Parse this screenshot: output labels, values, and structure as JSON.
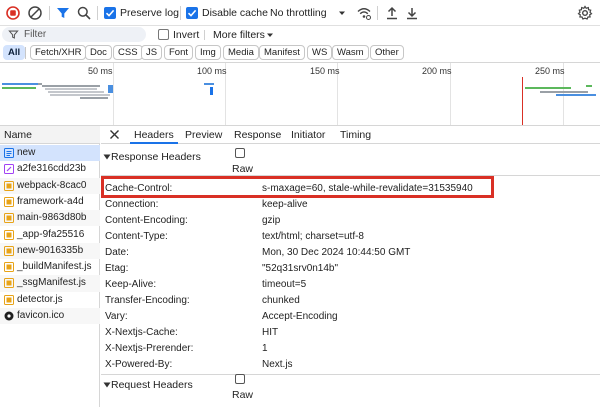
{
  "toolbar": {
    "preserve_log_label": "Preserve log",
    "disable_cache_label": "Disable cache",
    "throttling_value": "No throttling"
  },
  "filter": {
    "placeholder": "Filter",
    "invert_label": "Invert",
    "more_filters_label": "More filters"
  },
  "type_filters": [
    "All",
    "Fetch/XHR",
    "Doc",
    "CSS",
    "JS",
    "Font",
    "Img",
    "Media",
    "Manifest",
    "WS",
    "Wasm",
    "Other"
  ],
  "overview": {
    "ticks": [
      "50 ms",
      "100 ms",
      "150 ms",
      "200 ms",
      "250 ms"
    ]
  },
  "requests": {
    "header": "Name",
    "items": [
      {
        "name": "new",
        "type": "doc"
      },
      {
        "name": "a2fe316cdd23b",
        "type": "css"
      },
      {
        "name": "webpack-8cac0",
        "type": "js"
      },
      {
        "name": "framework-a4d",
        "type": "js"
      },
      {
        "name": "main-9863d80b",
        "type": "js"
      },
      {
        "name": "_app-9fa25516",
        "type": "js"
      },
      {
        "name": "new-9016335b",
        "type": "js"
      },
      {
        "name": "_buildManifest.js",
        "type": "js"
      },
      {
        "name": "_ssgManifest.js",
        "type": "js"
      },
      {
        "name": "detector.js",
        "type": "js"
      },
      {
        "name": "favicon.ico",
        "type": "icon"
      }
    ]
  },
  "tabs": [
    "Headers",
    "Preview",
    "Response",
    "Initiator",
    "Timing"
  ],
  "response_headers": {
    "title": "Response Headers",
    "raw_label": "Raw",
    "rows": [
      {
        "name": "Cache-Control:",
        "value": "s-maxage=60, stale-while-revalidate=31535940"
      },
      {
        "name": "Connection:",
        "value": "keep-alive"
      },
      {
        "name": "Content-Encoding:",
        "value": "gzip"
      },
      {
        "name": "Content-Type:",
        "value": "text/html; charset=utf-8"
      },
      {
        "name": "Date:",
        "value": "Mon, 30 Dec 2024 10:44:50 GMT"
      },
      {
        "name": "Etag:",
        "value": "\"52q31srv0n14b\""
      },
      {
        "name": "Keep-Alive:",
        "value": "timeout=5"
      },
      {
        "name": "Transfer-Encoding:",
        "value": "chunked"
      },
      {
        "name": "Vary:",
        "value": "Accept-Encoding"
      },
      {
        "name": "X-Nextjs-Cache:",
        "value": "HIT"
      },
      {
        "name": "X-Nextjs-Prerender:",
        "value": "1"
      },
      {
        "name": "X-Powered-By:",
        "value": "Next.js"
      }
    ]
  },
  "request_headers": {
    "title": "Request Headers",
    "raw_label": "Raw"
  },
  "colors": {
    "accent": "#1a73e8",
    "selected_row": "#d3e3fd",
    "highlight": "#d93025"
  }
}
